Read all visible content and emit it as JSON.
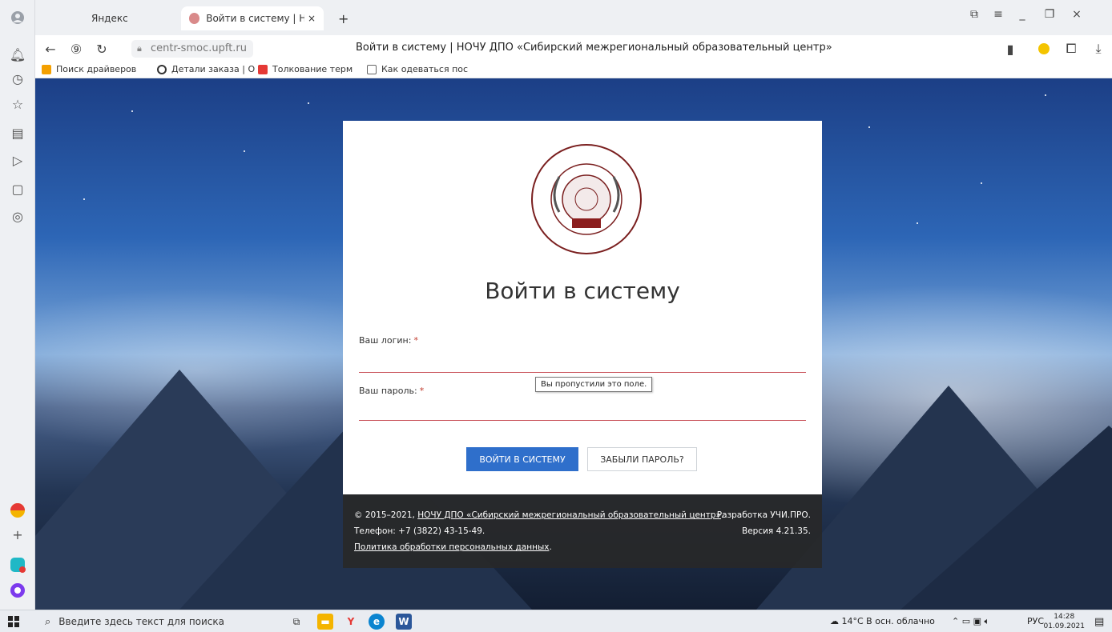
{
  "browser": {
    "tabs": [
      {
        "label": "Яндекс",
        "active": false
      },
      {
        "label": "Войти в систему | НОЧУ",
        "active": true
      }
    ],
    "new_tab": "+",
    "url": "centr-smoc.upft.ru",
    "page_title": "Войти в систему | НОЧУ ДПО «Сибирский межрегиональный образовательный центр»",
    "bookmarks": [
      "Поиск драйверов",
      "Детали заказа | О",
      "Толкование терм",
      "Как одеваться пос"
    ]
  },
  "login": {
    "title": "Войти в систему",
    "login_label": "Ваш логин:",
    "password_label": "Ваш пароль:",
    "required_mark": "*",
    "tooltip": "Вы пропустили это поле.",
    "submit_label": "ВОЙТИ В СИСТЕМУ",
    "forgot_label": "ЗАБЫЛИ ПАРОЛЬ?"
  },
  "footer": {
    "copyright_prefix": "© 2015–2021,",
    "org_link": "НОЧУ ДПО «Сибирский межрегиональный образовательный центр»",
    "period": ".",
    "phone": "Телефон: +7 (3822) 43-15-49.",
    "privacy_link": "Политика обработки персональных данных",
    "developer": "Разработка УЧИ.ПРО.",
    "version": "Версия 4.21.35."
  },
  "taskbar": {
    "search_placeholder": "Введите здесь текст для поиска",
    "weather": "14°C  В осн. облачно",
    "lang": "РУС",
    "time": "14:28",
    "date": "01.09.2021"
  },
  "colors": {
    "primary": "#2f6fcb",
    "error_underline": "#c9525a",
    "footer_bg": "#282828"
  }
}
